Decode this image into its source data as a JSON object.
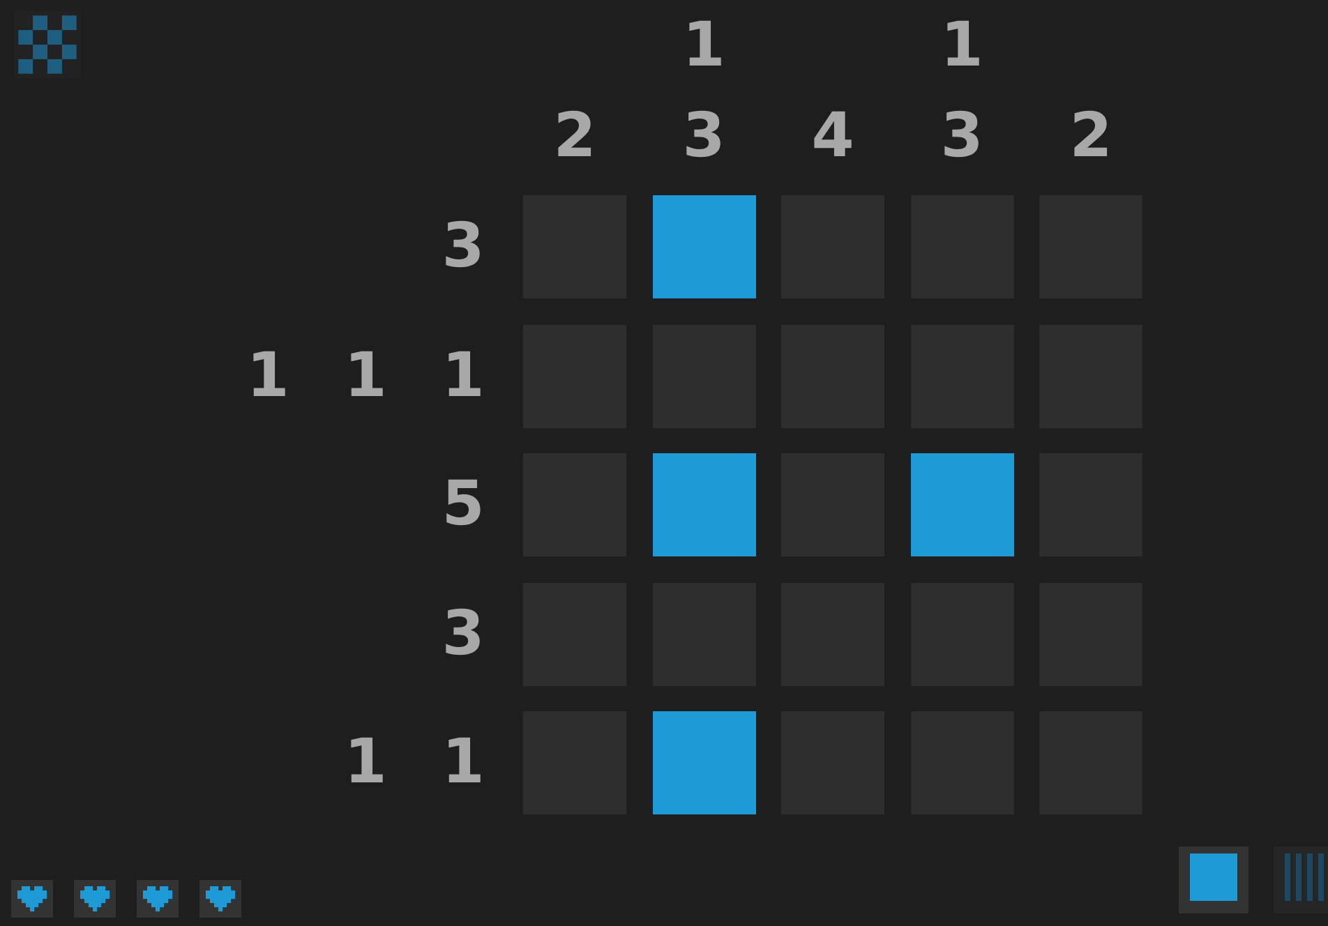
{
  "column_clues": [
    [
      "2"
    ],
    [
      "1",
      "3"
    ],
    [
      "4"
    ],
    [
      "1",
      "3"
    ],
    [
      "2"
    ]
  ],
  "row_clues": [
    [
      "3"
    ],
    [
      "1",
      "1",
      "1"
    ],
    [
      "5"
    ],
    [
      "3"
    ],
    [
      "1",
      "1"
    ]
  ],
  "cells": [
    [
      {
        "filled": false
      },
      {
        "filled": true
      },
      {
        "filled": false
      },
      {
        "filled": false
      },
      {
        "filled": false
      }
    ],
    [
      {
        "filled": false
      },
      {
        "filled": false
      },
      {
        "filled": false
      },
      {
        "filled": false
      },
      {
        "filled": false
      }
    ],
    [
      {
        "filled": false
      },
      {
        "filled": true
      },
      {
        "filled": false
      },
      {
        "filled": true
      },
      {
        "filled": false
      }
    ],
    [
      {
        "filled": false
      },
      {
        "filled": false
      },
      {
        "filled": false
      },
      {
        "filled": false
      },
      {
        "filled": false
      }
    ],
    [
      {
        "filled": false
      },
      {
        "filled": true
      },
      {
        "filled": false
      },
      {
        "filled": false
      },
      {
        "filled": false
      }
    ]
  ],
  "lives": [
    {
      "full": true
    },
    {
      "full": true
    },
    {
      "full": true
    },
    {
      "full": true
    }
  ],
  "tools": [
    {
      "kind": "fill",
      "selected": true
    },
    {
      "kind": "cross",
      "selected": false
    }
  ]
}
